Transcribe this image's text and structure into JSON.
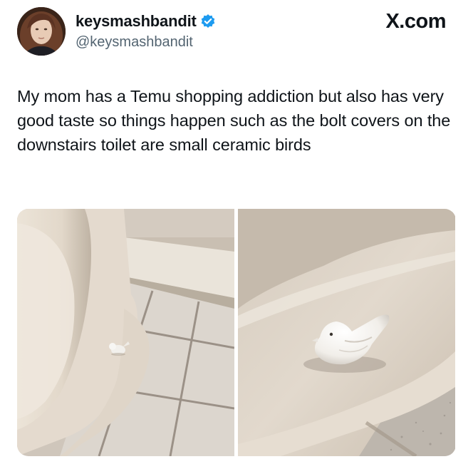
{
  "user": {
    "display_name": "keysmashbandit",
    "handle": "@keysmashbandit",
    "verified": true,
    "avatar_icon": "profile-photo"
  },
  "site_label": "X.com",
  "tweet": {
    "text": "My mom has a Temu shopping addiction but also has very good taste so things happen such as the bolt covers on the downstairs toilet are small ceramic birds"
  },
  "media": {
    "count": 2,
    "photos": [
      {
        "icon": "toilet-base-with-bird-photo"
      },
      {
        "icon": "ceramic-bird-closeup-photo"
      }
    ]
  },
  "colors": {
    "text": "#0f1419",
    "secondary_text": "#536471",
    "verified_badge": "#1d9bf0"
  }
}
